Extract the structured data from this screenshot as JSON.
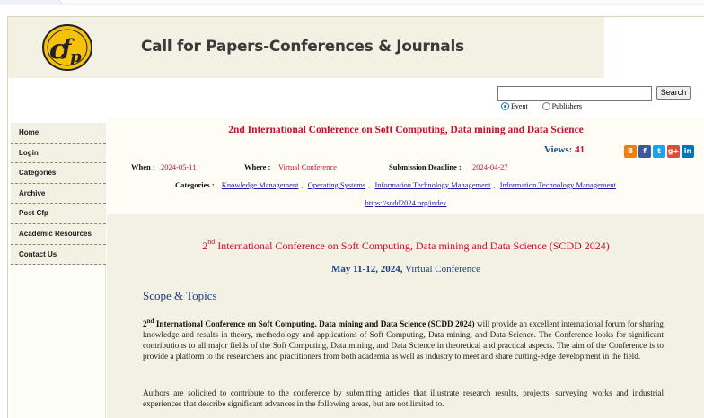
{
  "header": {
    "title": "Call for Papers-Conferences & Journals",
    "logo_text": "cfp"
  },
  "search": {
    "placeholder": "",
    "button_label": "Search",
    "options": [
      "Event",
      "Publishers"
    ],
    "selected": "Event"
  },
  "sidebar": {
    "items": [
      {
        "label": "Home"
      },
      {
        "label": "Login"
      },
      {
        "label": "Categories"
      },
      {
        "label": "Archive"
      },
      {
        "label": "Post Cfp"
      },
      {
        "label": "Academic Resources"
      },
      {
        "label": "Contact Us"
      }
    ]
  },
  "event": {
    "title": "2nd International Conference on Soft Computing, Data mining and Data Science",
    "views_label": "Views:",
    "views_count": "41",
    "when_label": "When :",
    "when_value": "2024-05-11",
    "where_label": "Where :",
    "where_value": "Virtual Conference",
    "deadline_label": "Submission Deadline :",
    "deadline_value": "2024-04-27",
    "categories_label": "Categories :",
    "categories": [
      "Knowledge Management",
      "Operating Systems",
      "Information Technology Management",
      "Information Technology Management"
    ],
    "url": "https://scdd2024.org/index"
  },
  "share_icons": [
    "blogger-icon",
    "facebook-icon",
    "twitter-icon",
    "googleplus-icon",
    "linkedin-icon"
  ],
  "body": {
    "heading_num": "2",
    "heading_sup": "nd",
    "heading_rest": " International Conference on Soft Computing, Data mining and Data Science (SCDD 2024)",
    "dates_bold": "May 11-12, 2024,",
    "dates_rest": " Virtual Conference",
    "scope_heading": "Scope & Topics",
    "para1_num": "2",
    "para1_sup": "nd",
    "para1_bold": " International Conference on Soft Computing, Data mining and Data Science (SCDD 2024)",
    "para1_rest": " will provide an excellent international forum for sharing knowledge and results in theory, methodology and applications of Soft Computing, Data mining, and Data Science. The Conference looks for significant contributions to all major fields of the Soft Computing, Data mining, and Data Science in theoretical and practical aspects. The aim of the Conference is to provide a platform to the researchers and practitioners from both academia as well as industry to meet and share cutting-edge development in the field.",
    "para2": "Authors are solicited to contribute to the conference by submitting articles that illustrate research results, projects, surveying works and industrial experiences that describe significant advances in the following areas, but are not limited to."
  },
  "colors": {
    "accent_red": "#c8102e",
    "link_blue": "#1a1aa6",
    "heading_blue": "#1f3f7f",
    "panel_beige": "#f3f1e3"
  }
}
